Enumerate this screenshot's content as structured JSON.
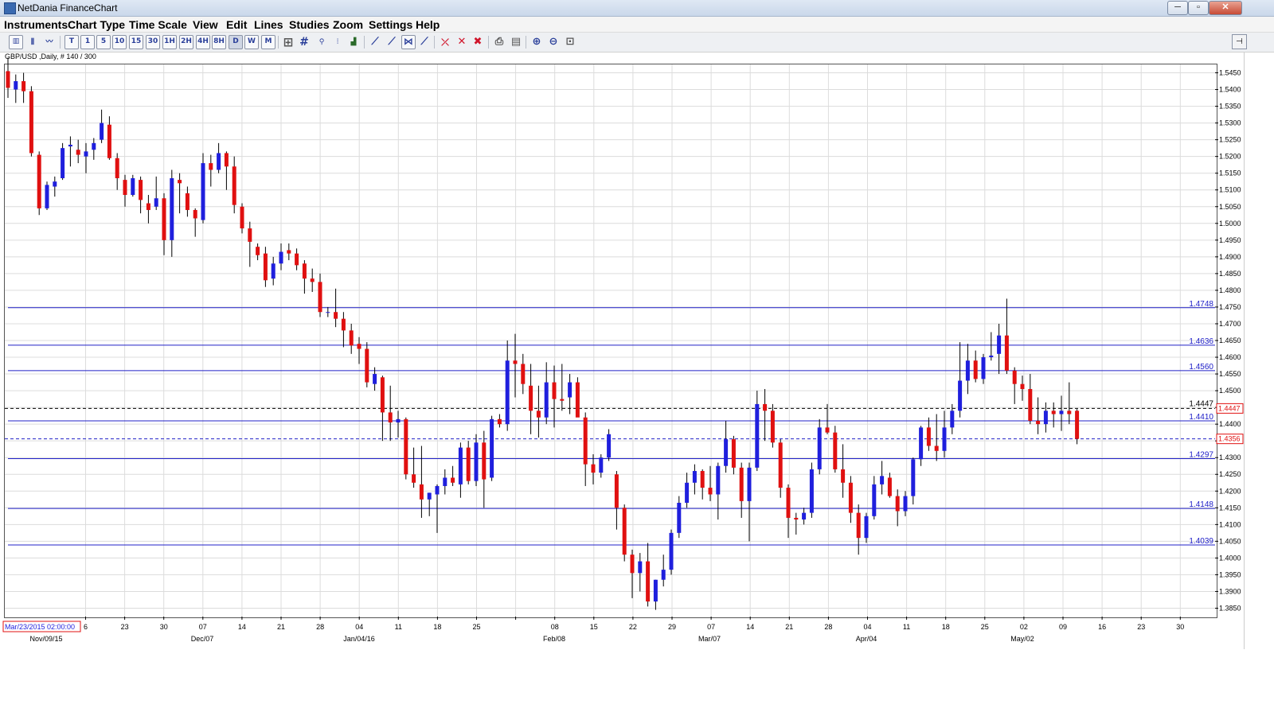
{
  "window": {
    "title": "NetDania FinanceChart",
    "min": "─",
    "max": "▫",
    "close": "✕"
  },
  "menu": [
    "Instruments",
    "Chart Type",
    "Time Scale",
    "View",
    "Edit",
    "Lines",
    "Studies",
    "Zoom",
    "Settings",
    "Help"
  ],
  "toolbar": {
    "timeframes": [
      "T",
      "1",
      "5",
      "10",
      "15",
      "30",
      "1H",
      "2H",
      "4H",
      "8H",
      "D",
      "W",
      "M"
    ],
    "selected_timeframe": "D",
    "icons": [
      "candlestick-chart-icon",
      "bar-chart-icon",
      "line-chart-icon",
      "crosshair-icon",
      "grid-icon",
      "study-icon",
      "volume-icon",
      "histogram-icon",
      "trend-icon",
      "delete-line-icon",
      "delete-all-icon",
      "print-icon",
      "print-preview-icon",
      "zoom-in-icon",
      "zoom-out-icon",
      "zoom-reset-icon"
    ]
  },
  "symbol_label": "GBP/USD ,Daily, # 140 / 300",
  "colors": {
    "up": "#1f1fdd",
    "down": "#e01010",
    "hline": "#2020c8",
    "grid": "#dcdcdc"
  },
  "chart_data": {
    "type": "candlestick",
    "ylim": [
      1.3825,
      1.5475
    ],
    "y_ticks": [
      "1.3850",
      "1.3900",
      "1.3950",
      "1.4000",
      "1.4050",
      "1.4100",
      "1.4150",
      "1.4200",
      "1.4250",
      "1.4300",
      "1.4350",
      "1.4400",
      "1.4450",
      "1.4500",
      "1.4550",
      "1.4600",
      "1.4650",
      "1.4700",
      "1.4750",
      "1.4800",
      "1.4850",
      "1.4900",
      "1.4950",
      "1.5000",
      "1.5050",
      "1.5100",
      "1.5150",
      "1.5200",
      "1.5250",
      "1.5300",
      "1.5350",
      "1.5400",
      "1.5450"
    ],
    "x_ticks": [
      "6",
      "23",
      "30",
      "07",
      "14",
      "21",
      "28",
      "04",
      "11",
      "18",
      "25",
      "",
      "08",
      "15",
      "22",
      "29",
      "07",
      "14",
      "21",
      "28",
      "04",
      "11",
      "18",
      "25",
      "02",
      "09",
      "16",
      "23",
      "30"
    ],
    "x_major": [
      "Nov/09/15",
      "Dec/07",
      "Jan/04/16",
      "Feb/08",
      "Mar/07",
      "Apr/04",
      "May/02"
    ],
    "crosshair_date": "Mar/23/2015 02:00:00",
    "levels": [
      "1.4748",
      "1.4636",
      "1.4560",
      "1.4410",
      "1.4297",
      "1.4148",
      "1.4039"
    ],
    "current_price": "1.4447",
    "current_tag": "1.4447",
    "bid_price": "1.4356",
    "bid_tag": "1.4356",
    "candles": [
      [
        1.5455,
        1.5495,
        1.5375,
        1.5405
      ],
      [
        1.54,
        1.5445,
        1.536,
        1.5425
      ],
      [
        1.5425,
        1.545,
        1.536,
        1.5395
      ],
      [
        1.5395,
        1.541,
        1.52,
        1.521
      ],
      [
        1.5205,
        1.5215,
        1.5025,
        1.5045
      ],
      [
        1.5045,
        1.5125,
        1.504,
        1.5115
      ],
      [
        1.511,
        1.514,
        1.508,
        1.5125
      ],
      [
        1.5135,
        1.524,
        1.513,
        1.5225
      ],
      [
        1.523,
        1.526,
        1.517,
        1.5235
      ],
      [
        1.522,
        1.525,
        1.518,
        1.5205
      ],
      [
        1.52,
        1.524,
        1.515,
        1.5215
      ],
      [
        1.522,
        1.5255,
        1.519,
        1.524
      ],
      [
        1.525,
        1.534,
        1.524,
        1.53
      ],
      [
        1.5295,
        1.532,
        1.519,
        1.5195
      ],
      [
        1.5195,
        1.521,
        1.51,
        1.5135
      ],
      [
        1.513,
        1.5145,
        1.505,
        1.5085
      ],
      [
        1.5085,
        1.5145,
        1.508,
        1.5135
      ],
      [
        1.513,
        1.514,
        1.503,
        1.507
      ],
      [
        1.506,
        1.5085,
        1.5,
        1.504
      ],
      [
        1.505,
        1.514,
        1.504,
        1.5075
      ],
      [
        1.5075,
        1.509,
        1.4905,
        1.495
      ],
      [
        1.495,
        1.516,
        1.49,
        1.5135
      ],
      [
        1.513,
        1.515,
        1.503,
        1.512
      ],
      [
        1.509,
        1.511,
        1.502,
        1.504
      ],
      [
        1.504,
        1.5045,
        1.496,
        1.5015
      ],
      [
        1.501,
        1.521,
        1.5,
        1.518
      ],
      [
        1.518,
        1.5205,
        1.511,
        1.516
      ],
      [
        1.516,
        1.524,
        1.515,
        1.521
      ],
      [
        1.521,
        1.5215,
        1.51,
        1.517
      ],
      [
        1.517,
        1.52,
        1.503,
        1.5055
      ],
      [
        1.505,
        1.506,
        1.497,
        1.4985
      ],
      [
        1.4985,
        1.5005,
        1.487,
        1.4945
      ],
      [
        1.493,
        1.494,
        1.489,
        1.4905
      ],
      [
        1.491,
        1.493,
        1.481,
        1.483
      ],
      [
        1.4835,
        1.49,
        1.4815,
        1.488
      ],
      [
        1.488,
        1.494,
        1.486,
        1.4915
      ],
      [
        1.492,
        1.494,
        1.489,
        1.491
      ],
      [
        1.491,
        1.4925,
        1.486,
        1.4875
      ],
      [
        1.488,
        1.489,
        1.479,
        1.4835
      ],
      [
        1.4835,
        1.4865,
        1.4795,
        1.4825
      ],
      [
        1.4825,
        1.485,
        1.472,
        1.4735
      ],
      [
        1.4735,
        1.475,
        1.472,
        1.4735
      ],
      [
        1.4735,
        1.4805,
        1.469,
        1.4715
      ],
      [
        1.4715,
        1.4735,
        1.463,
        1.468
      ],
      [
        1.468,
        1.47,
        1.461,
        1.4635
      ],
      [
        1.464,
        1.466,
        1.458,
        1.4625
      ],
      [
        1.4625,
        1.4645,
        1.451,
        1.4525
      ],
      [
        1.452,
        1.457,
        1.45,
        1.455
      ],
      [
        1.454,
        1.4545,
        1.435,
        1.4435
      ],
      [
        1.4435,
        1.4515,
        1.435,
        1.4405
      ],
      [
        1.4405,
        1.444,
        1.436,
        1.4415
      ],
      [
        1.4415,
        1.442,
        1.4235,
        1.425
      ],
      [
        1.425,
        1.433,
        1.421,
        1.4225
      ],
      [
        1.422,
        1.4335,
        1.412,
        1.4175
      ],
      [
        1.4175,
        1.4195,
        1.4125,
        1.4195
      ],
      [
        1.419,
        1.422,
        1.4075,
        1.4215
      ],
      [
        1.4215,
        1.4265,
        1.419,
        1.424
      ],
      [
        1.424,
        1.4275,
        1.4215,
        1.4225
      ],
      [
        1.422,
        1.4345,
        1.418,
        1.433
      ],
      [
        1.433,
        1.435,
        1.422,
        1.423
      ],
      [
        1.423,
        1.437,
        1.4215,
        1.4345
      ],
      [
        1.4345,
        1.438,
        1.415,
        1.4235
      ],
      [
        1.424,
        1.4425,
        1.423,
        1.4415
      ],
      [
        1.4415,
        1.443,
        1.439,
        1.44
      ],
      [
        1.44,
        1.465,
        1.438,
        1.459
      ],
      [
        1.459,
        1.467,
        1.448,
        1.458
      ],
      [
        1.458,
        1.461,
        1.449,
        1.452
      ],
      [
        1.4515,
        1.458,
        1.437,
        1.444
      ],
      [
        1.444,
        1.4515,
        1.436,
        1.442
      ],
      [
        1.442,
        1.4585,
        1.44,
        1.4525
      ],
      [
        1.4525,
        1.4575,
        1.439,
        1.4475
      ],
      [
        1.4475,
        1.458,
        1.444,
        1.447
      ],
      [
        1.448,
        1.455,
        1.443,
        1.4525
      ],
      [
        1.4525,
        1.454,
        1.444,
        1.442
      ],
      [
        1.442,
        1.4435,
        1.4215,
        1.428
      ],
      [
        1.428,
        1.431,
        1.422,
        1.4255
      ],
      [
        1.4255,
        1.431,
        1.424,
        1.43
      ],
      [
        1.43,
        1.4385,
        1.429,
        1.437
      ],
      [
        1.425,
        1.426,
        1.4085,
        1.415
      ],
      [
        1.415,
        1.416,
        1.399,
        1.401
      ],
      [
        1.401,
        1.4025,
        1.388,
        1.3955
      ],
      [
        1.3955,
        1.4015,
        1.39,
        1.399
      ],
      [
        1.399,
        1.4045,
        1.3855,
        1.387
      ],
      [
        1.387,
        1.3935,
        1.3845,
        1.3935
      ],
      [
        1.3935,
        1.401,
        1.3915,
        1.3965
      ],
      [
        1.3965,
        1.4085,
        1.395,
        1.4075
      ],
      [
        1.4075,
        1.4185,
        1.406,
        1.4165
      ],
      [
        1.4165,
        1.4255,
        1.415,
        1.4225
      ],
      [
        1.4225,
        1.428,
        1.419,
        1.426
      ],
      [
        1.426,
        1.4265,
        1.4175,
        1.421
      ],
      [
        1.421,
        1.4275,
        1.417,
        1.419
      ],
      [
        1.419,
        1.4285,
        1.4115,
        1.4275
      ],
      [
        1.4275,
        1.441,
        1.4255,
        1.4355
      ],
      [
        1.4355,
        1.4365,
        1.425,
        1.427
      ],
      [
        1.427,
        1.4285,
        1.412,
        1.417
      ],
      [
        1.417,
        1.4285,
        1.405,
        1.427
      ],
      [
        1.427,
        1.45,
        1.426,
        1.446
      ],
      [
        1.446,
        1.4505,
        1.435,
        1.444
      ],
      [
        1.444,
        1.446,
        1.433,
        1.4345
      ],
      [
        1.4345,
        1.4355,
        1.418,
        1.421
      ],
      [
        1.421,
        1.422,
        1.406,
        1.412
      ],
      [
        1.412,
        1.4135,
        1.407,
        1.4115
      ],
      [
        1.4115,
        1.415,
        1.41,
        1.4135
      ],
      [
        1.4135,
        1.4285,
        1.412,
        1.4265
      ],
      [
        1.4265,
        1.4415,
        1.425,
        1.439
      ],
      [
        1.439,
        1.446,
        1.437,
        1.4375
      ],
      [
        1.4375,
        1.4395,
        1.4255,
        1.4265
      ],
      [
        1.4265,
        1.434,
        1.418,
        1.4225
      ],
      [
        1.4225,
        1.4245,
        1.4105,
        1.4135
      ],
      [
        1.4135,
        1.416,
        1.401,
        1.406
      ],
      [
        1.406,
        1.4135,
        1.4045,
        1.4125
      ],
      [
        1.4125,
        1.4245,
        1.4115,
        1.422
      ],
      [
        1.422,
        1.429,
        1.419,
        1.4245
      ],
      [
        1.424,
        1.4255,
        1.418,
        1.4185
      ],
      [
        1.4185,
        1.4205,
        1.4095,
        1.414
      ],
      [
        1.414,
        1.42,
        1.4125,
        1.4185
      ],
      [
        1.4185,
        1.43,
        1.416,
        1.4295
      ],
      [
        1.4295,
        1.4395,
        1.4275,
        1.439
      ],
      [
        1.439,
        1.442,
        1.432,
        1.4335
      ],
      [
        1.4335,
        1.443,
        1.429,
        1.432
      ],
      [
        1.432,
        1.444,
        1.43,
        1.439
      ],
      [
        1.439,
        1.446,
        1.437,
        1.444
      ],
      [
        1.444,
        1.4645,
        1.442,
        1.453
      ],
      [
        1.453,
        1.464,
        1.449,
        1.459
      ],
      [
        1.459,
        1.462,
        1.4525,
        1.4535
      ],
      [
        1.4535,
        1.461,
        1.452,
        1.46
      ],
      [
        1.46,
        1.4675,
        1.459,
        1.4605
      ],
      [
        1.461,
        1.47,
        1.455,
        1.4665
      ],
      [
        1.4665,
        1.4775,
        1.455,
        1.456
      ],
      [
        1.456,
        1.457,
        1.446,
        1.452
      ],
      [
        1.452,
        1.4545,
        1.447,
        1.4505
      ],
      [
        1.4505,
        1.455,
        1.44,
        1.441
      ],
      [
        1.441,
        1.448,
        1.437,
        1.44
      ],
      [
        1.44,
        1.4465,
        1.4375,
        1.444
      ],
      [
        1.444,
        1.4465,
        1.439,
        1.443
      ],
      [
        1.443,
        1.4485,
        1.438,
        1.444
      ],
      [
        1.444,
        1.4525,
        1.44,
        1.443
      ],
      [
        1.444,
        1.4445,
        1.434,
        1.4356
      ]
    ]
  }
}
